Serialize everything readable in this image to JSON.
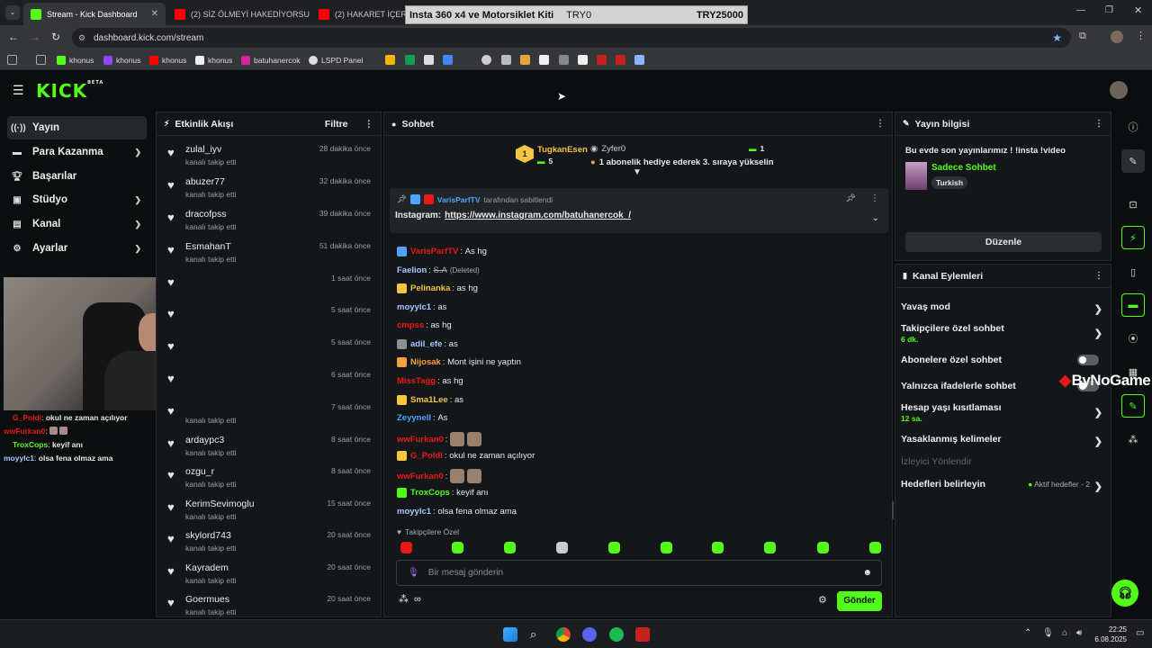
{
  "browser": {
    "tabs": [
      {
        "label": "Stream - Kick Dashboard",
        "active": true
      },
      {
        "label": "(2) SİZ ÖLMEYİ HAKEDİYORSUN",
        "active": false
      },
      {
        "label": "(2) HAKARET İÇERİRİ Tü",
        "active": false
      }
    ],
    "url": "dashboard.kick.com/stream",
    "bookmarks": [
      "khonus",
      "khonus",
      "khonus",
      "khonus",
      "batuhanercok",
      "LSPD Panel"
    ]
  },
  "overlay_banner": {
    "title": "Insta 360 x4 ve Motorsiklet Kiti",
    "current": "TRY0",
    "goal": "TRY25000"
  },
  "header": {
    "logo": "KICK",
    "logo_sup": "BETA"
  },
  "left_nav": [
    {
      "label": "Yayın",
      "icon": "broadcast-icon",
      "active": true,
      "expand": false
    },
    {
      "label": "Para Kazanma",
      "icon": "money-icon",
      "expand": true
    },
    {
      "label": "Başarılar",
      "icon": "trophy-icon",
      "expand": false
    },
    {
      "label": "Stüdyo",
      "icon": "studio-icon",
      "expand": true
    },
    {
      "label": "Kanal",
      "icon": "channel-icon",
      "expand": true
    },
    {
      "label": "Ayarlar",
      "icon": "gear-icon",
      "expand": true
    }
  ],
  "overlay_chat": [
    {
      "user": "G_Poldi",
      "msg": "okul ne zaman açılıyor",
      "color": "#e91916"
    },
    {
      "user": "wwFurkan0",
      "msg": "",
      "color": "#e91916"
    },
    {
      "user": "TroxCops",
      "msg": "keyif anı",
      "color": "#53fc18"
    },
    {
      "user": "moyylc1",
      "msg": "olsa fena olmaz ama",
      "color": "#a9c7ff"
    }
  ],
  "activity": {
    "title": "Etkinlik Akışı",
    "filter_label": "Filtre",
    "items": [
      {
        "name": "zulal_iyv",
        "action": "kanalı takip etti",
        "time": "28 dakika önce"
      },
      {
        "name": "abuzer77",
        "action": "kanalı takip etti",
        "time": "32 dakika önce"
      },
      {
        "name": "dracofpss",
        "action": "kanalı takip etti",
        "time": "39 dakika önce"
      },
      {
        "name": "EsmahanT",
        "action": "kanalı takip etti",
        "time": "51 dakika önce"
      },
      {
        "name": "",
        "action": "",
        "time": "1 saat önce"
      },
      {
        "name": "",
        "action": "",
        "time": "5 saat önce"
      },
      {
        "name": "",
        "action": "",
        "time": "5 saat önce"
      },
      {
        "name": "",
        "action": "",
        "time": "6 saat önce"
      },
      {
        "name": "",
        "action": "kanalı takip etti",
        "time": "7 saat önce"
      },
      {
        "name": "ardaypc3",
        "action": "kanalı takip etti",
        "time": "8 saat önce"
      },
      {
        "name": "ozgu_r",
        "action": "kanalı takip etti",
        "time": "8 saat önce"
      },
      {
        "name": "KerimSevimoglu",
        "action": "kanalı takip etti",
        "time": "15 saat önce"
      },
      {
        "name": "skylord743",
        "action": "kanalı takip etti",
        "time": "20 saat önce"
      },
      {
        "name": "Kayradem",
        "action": "kanalı takip etti",
        "time": "20 saat önce"
      },
      {
        "name": "Goermues",
        "action": "kanalı takip etti",
        "time": "20 saat önce"
      }
    ]
  },
  "chat": {
    "title": "Sohbet",
    "leaderboard": {
      "rank": "1",
      "user1": "TugkanEsen",
      "user1_count": "5",
      "user2": "Zyfer0",
      "user2_count": "1",
      "gift_text": "1 abonelik hediye ederek 3. sıraya yükselin"
    },
    "pinned": {
      "by_user": "VarisParfTV",
      "by_text": "tarafından sabitlendi",
      "label": "Instagram:",
      "link": "https://www.instagram.com/batuhanercok_/"
    },
    "messages": [
      {
        "user": "VarisParfTV",
        "msg": "As hg",
        "color": "#e91916"
      },
      {
        "user": "Faelion",
        "msg": "S.A",
        "deleted": "(Deleted)",
        "color": "#a9c7ff"
      },
      {
        "user": "Pelinanka",
        "msg": "as hg",
        "color": "#f5c542"
      },
      {
        "user": "moyylc1",
        "msg": "as",
        "color": "#a9c7ff"
      },
      {
        "user": "cmpss",
        "msg": "as hg",
        "color": "#e91916"
      },
      {
        "user": "adil_efe",
        "msg": "as",
        "color": "#a9c7ff"
      },
      {
        "user": "Nijosak",
        "msg": "Mont işini ne yaptın",
        "color": "#f5a142"
      },
      {
        "user": "MissTagg",
        "msg": "as hg",
        "color": "#e91916"
      },
      {
        "user": "Sma1Lee",
        "msg": "as",
        "color": "#f5c542"
      },
      {
        "user": "Zeyynell",
        "msg": "As",
        "color": "#4da3ff"
      },
      {
        "user": "wwFurkan0",
        "msg": "",
        "color": "#e91916"
      },
      {
        "user": "G_Poldi",
        "msg": "okul ne zaman açılıyor",
        "color": "#e91916"
      },
      {
        "user": "wwFurkan0",
        "msg": "",
        "color": "#e91916"
      },
      {
        "user": "TroxCops",
        "msg": "keyif anı",
        "color": "#53fc18"
      },
      {
        "user": "moyylc1",
        "msg": "olsa fena olmaz ama",
        "color": "#a9c7ff"
      }
    ],
    "followers_only": "Takipçilere Özel",
    "input_placeholder": "Bir mesaj gönderin",
    "send_label": "Gönder"
  },
  "stream_info": {
    "title": "Yayın bilgisi",
    "stream_title": "Bu evde son yayınlarımız ! !insta !video",
    "category": "Sadece Sohbet",
    "tag": "Turkish",
    "edit_label": "Düzenle"
  },
  "channel_actions": {
    "title": "Kanal Eylemleri",
    "items": [
      {
        "label": "Yavaş mod",
        "sub": ""
      },
      {
        "label": "Takipçilere özel sohbet",
        "sub": "6 dk."
      },
      {
        "label": "Abonelere özel sohbet",
        "sub": ""
      },
      {
        "label": "Yalnızca ifadelerle sohbet",
        "sub": ""
      },
      {
        "label": "Hesap yaşı kısıtlaması",
        "sub": "12 sa."
      },
      {
        "label": "Yasaklanmış kelimeler",
        "sub": ""
      },
      {
        "label": "İzleyici Yönlendir",
        "sub": ""
      },
      {
        "label": "Hedefleri belirleyin",
        "sub": ""
      }
    ],
    "goals_status": "Aktif hedefler - 2"
  },
  "watermark": "ByNoGame",
  "taskbar": {
    "time": "22:25",
    "date": "6.08.2025"
  },
  "colors": {
    "accent": "#53fc18",
    "bg": "#0b0e0f",
    "panel": "#141719"
  }
}
